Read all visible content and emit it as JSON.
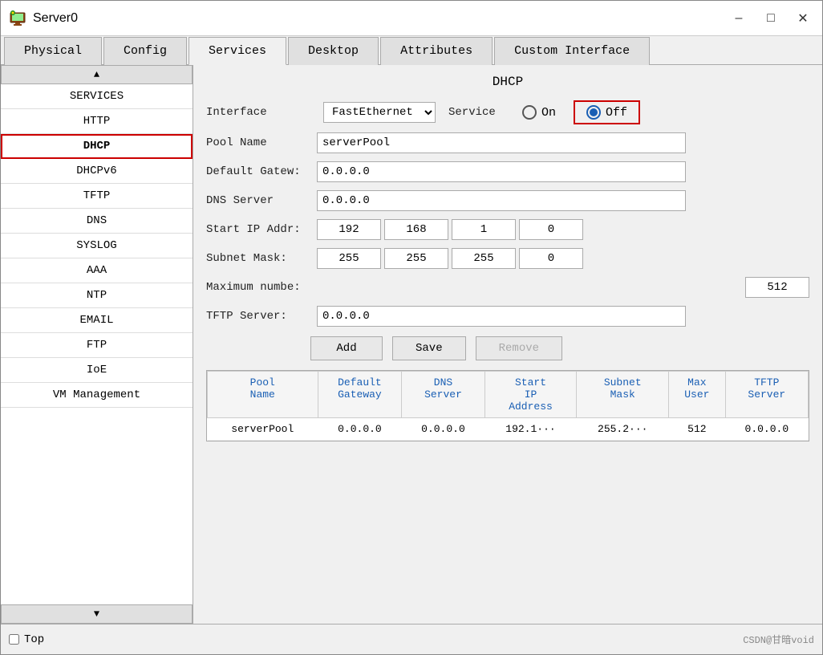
{
  "window": {
    "title": "Server0",
    "icon": "🖥"
  },
  "tabs": [
    {
      "label": "Physical",
      "active": false
    },
    {
      "label": "Config",
      "active": false
    },
    {
      "label": "Services",
      "active": true
    },
    {
      "label": "Desktop",
      "active": false
    },
    {
      "label": "Attributes",
      "active": false
    },
    {
      "label": "Custom Interface",
      "active": false
    }
  ],
  "sidebar": {
    "items": [
      {
        "label": "SERVICES",
        "selected": false
      },
      {
        "label": "HTTP",
        "selected": false
      },
      {
        "label": "DHCP",
        "selected": true
      },
      {
        "label": "DHCPv6",
        "selected": false
      },
      {
        "label": "TFTP",
        "selected": false
      },
      {
        "label": "DNS",
        "selected": false
      },
      {
        "label": "SYSLOG",
        "selected": false
      },
      {
        "label": "AAA",
        "selected": false
      },
      {
        "label": "NTP",
        "selected": false
      },
      {
        "label": "EMAIL",
        "selected": false
      },
      {
        "label": "FTP",
        "selected": false
      },
      {
        "label": "IoE",
        "selected": false
      },
      {
        "label": "VM Management",
        "selected": false
      }
    ]
  },
  "main": {
    "panel_title": "DHCP",
    "interface_label": "Interface",
    "interface_value": "FastEtherne ▼",
    "service_label": "Service",
    "on_label": "On",
    "off_label": "Off",
    "pool_name_label": "Pool Name",
    "pool_name_value": "serverPool",
    "default_gateway_label": "Default Gatew:",
    "default_gateway_value": "0.0.0.0",
    "dns_server_label": "DNS Server",
    "dns_server_value": "0.0.0.0",
    "start_ip_label": "Start IP Addr:",
    "start_ip_parts": [
      "192",
      "168",
      "1",
      "0"
    ],
    "subnet_mask_label": "Subnet Mask:",
    "subnet_mask_parts": [
      "255",
      "255",
      "255",
      "0"
    ],
    "max_users_label": "Maximum numbe:",
    "max_users_value": "512",
    "tftp_server_label": "TFTP Server:",
    "tftp_server_value": "0.0.0.0",
    "add_btn": "Add",
    "save_btn": "Save",
    "remove_btn": "Remove",
    "table": {
      "headers": [
        "Pool\nName",
        "Default\nGateway",
        "DNS\nServer",
        "Start\nIP\nAddress",
        "Subnet\nMask",
        "Max\nUser",
        "TFTP\nServer"
      ],
      "rows": [
        [
          "serverPool",
          "0.0.0.0",
          "0.0.0.0",
          "192.1···",
          "255.2···",
          "512",
          "0.0.0.0"
        ]
      ]
    }
  },
  "bottom": {
    "top_checkbox_label": "Top",
    "watermark": "CSDN@甘暗void"
  },
  "colors": {
    "accent_blue": "#1a5fb4",
    "accent_red": "#cc0000",
    "selected_border": "#cc0000"
  }
}
